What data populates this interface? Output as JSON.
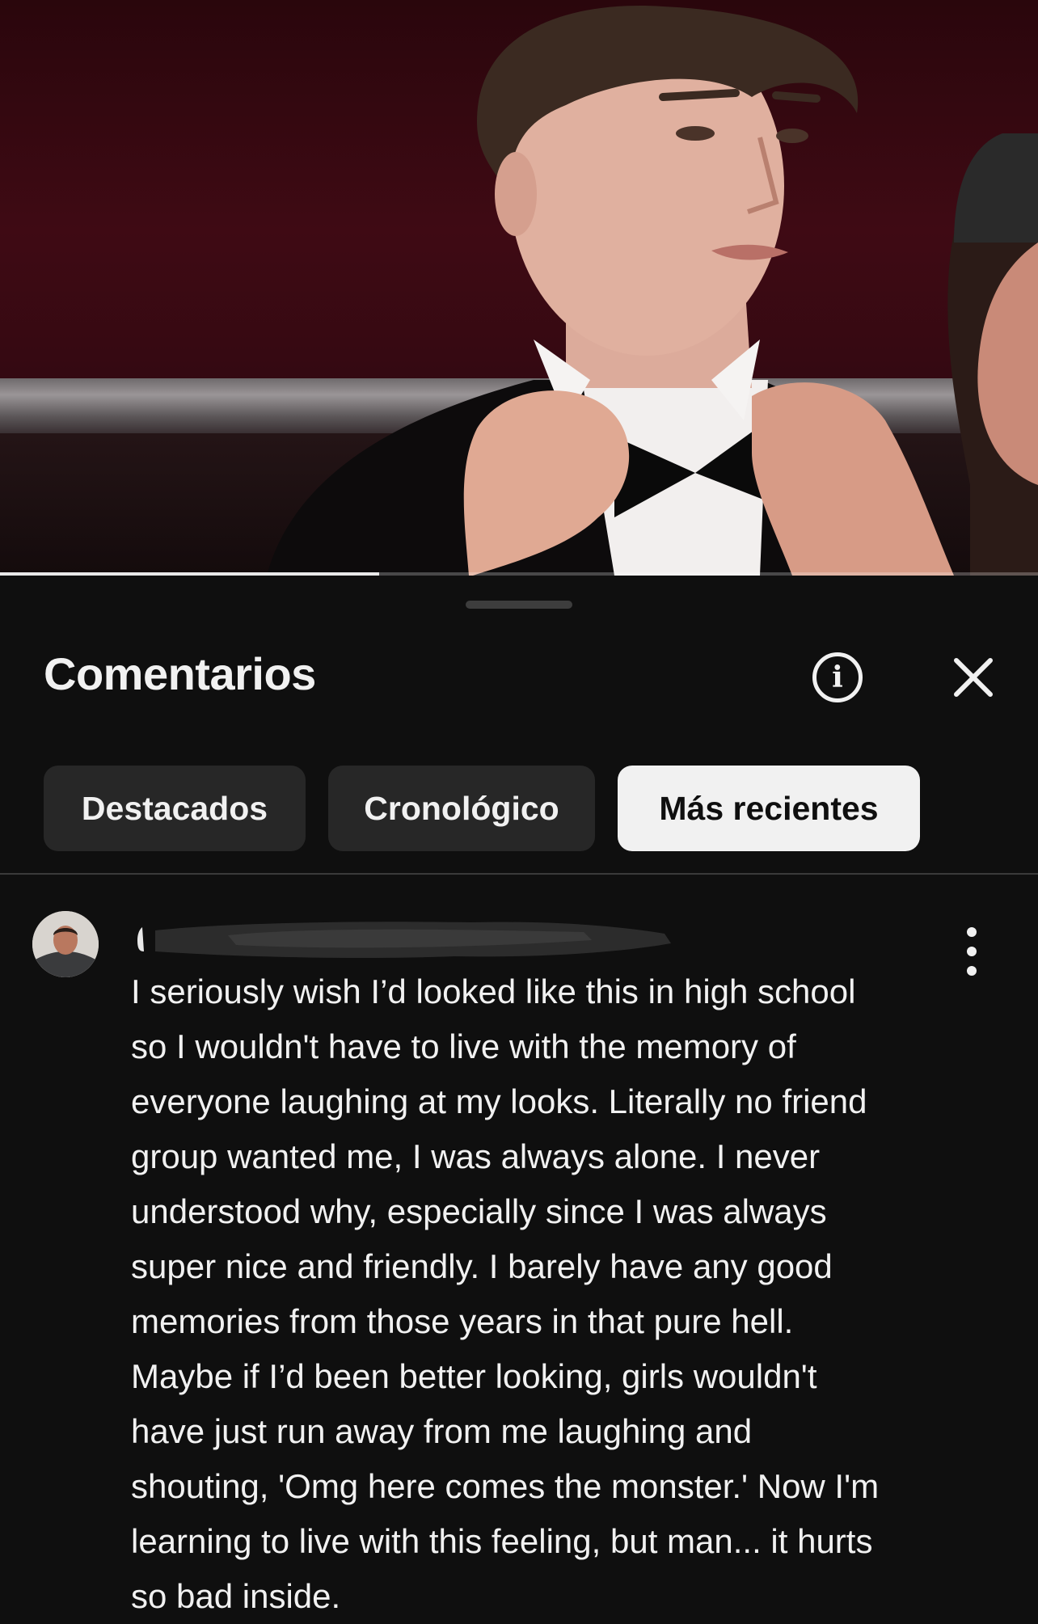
{
  "video": {
    "progress": 0.365
  },
  "comments_panel": {
    "title": "Comentarios",
    "info_icon": "info-icon",
    "close_icon": "close-icon",
    "filters": [
      {
        "label": "Destacados",
        "selected": false
      },
      {
        "label": "Cronológico",
        "selected": false
      },
      {
        "label": "Más recientes",
        "selected": true
      }
    ]
  },
  "comment": {
    "avatar_icon": "avatar",
    "username_redacted": true,
    "menu_icon": "more-vertical-icon",
    "lines": [
      "I seriously wish I’d looked like this in high school",
      "so I wouldn't have to live with the memory of",
      "everyone laughing at my looks. Literally no friend",
      "group wanted me, I was always alone. I never",
      "understood why, especially since I was always",
      "super nice and friendly. I barely have any good",
      "memories from those years in that pure hell.",
      "Maybe if I’d been better looking, girls wouldn't",
      "have just run away from me laughing and",
      "shouting, 'Omg here comes the monster.' Now I'm",
      "learning to live with this feeling, but man... it hurts",
      "so bad inside."
    ]
  },
  "colors": {
    "background": "#0f0f0f",
    "chip": "#272727",
    "chip_selected": "#f1f1f1",
    "text": "#f1f1f1"
  }
}
